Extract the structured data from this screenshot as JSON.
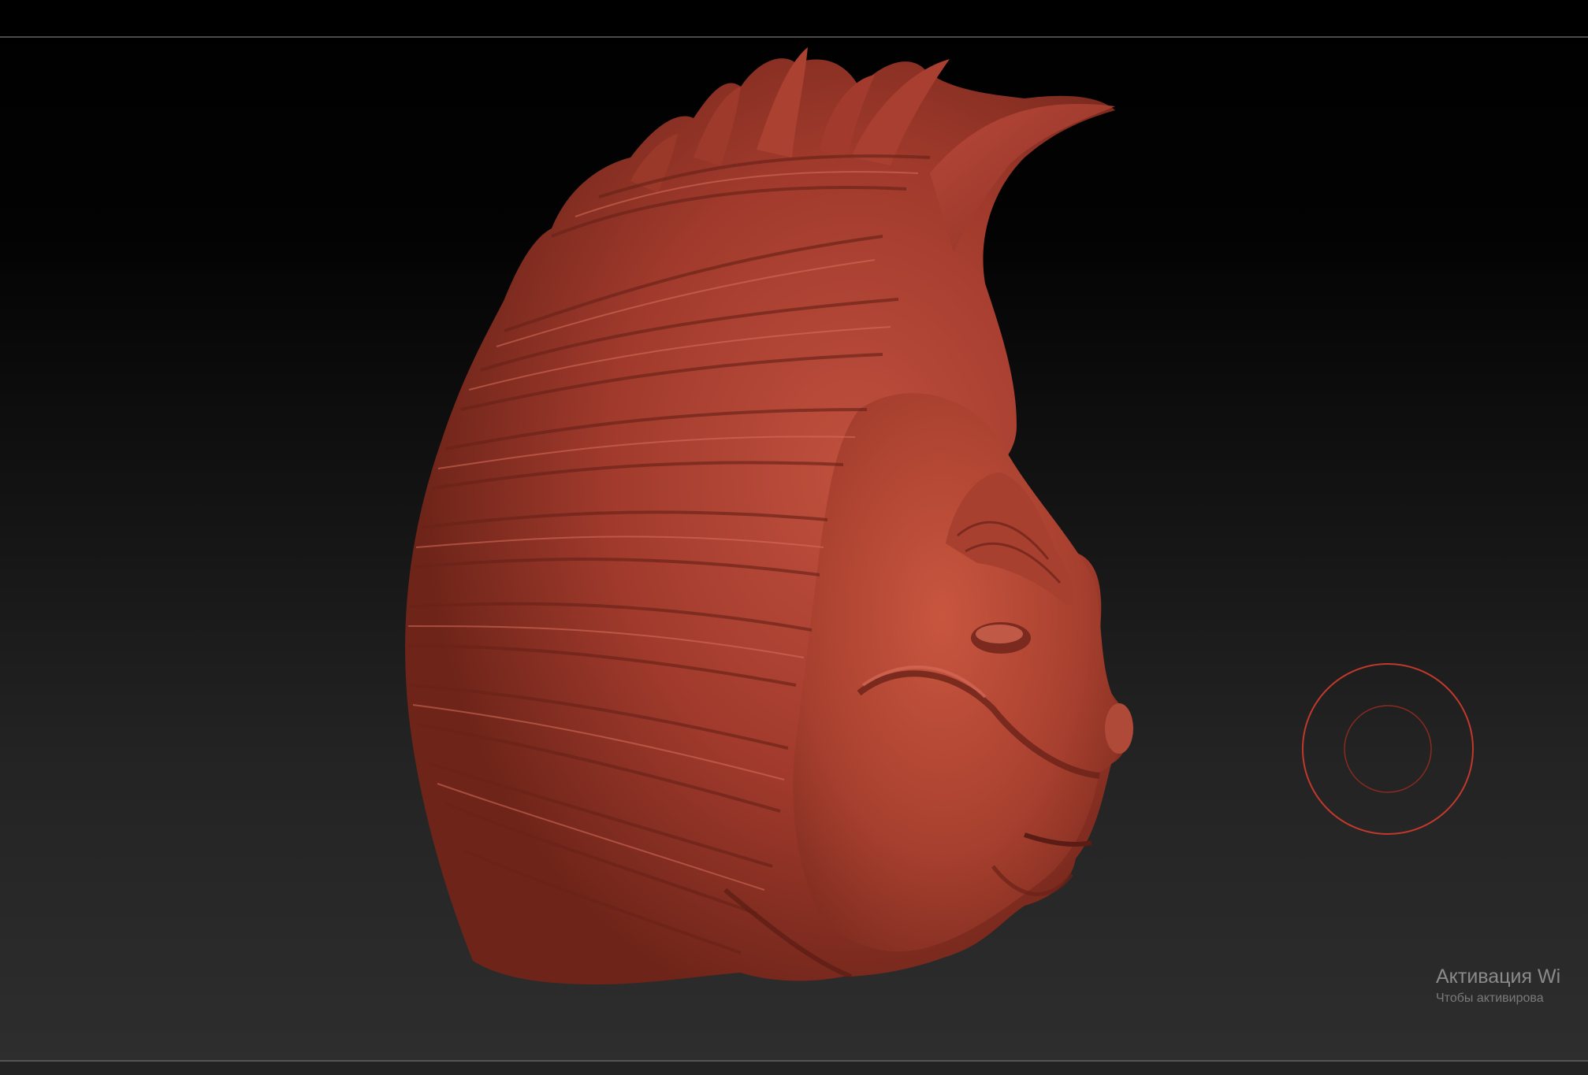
{
  "viewport": {
    "background_top": "#000000",
    "background_bottom": "#2e2e2e",
    "frame_line_color": "#4a4a4a"
  },
  "model": {
    "material_color": "#a23b2d",
    "material_highlight": "#d46a58",
    "material_shadow": "#5a1c14"
  },
  "brush_cursor": {
    "ring_color": "#c0392b"
  },
  "activation_notice": {
    "title": "Активация Wi",
    "subtitle": "Чтобы активирова"
  }
}
